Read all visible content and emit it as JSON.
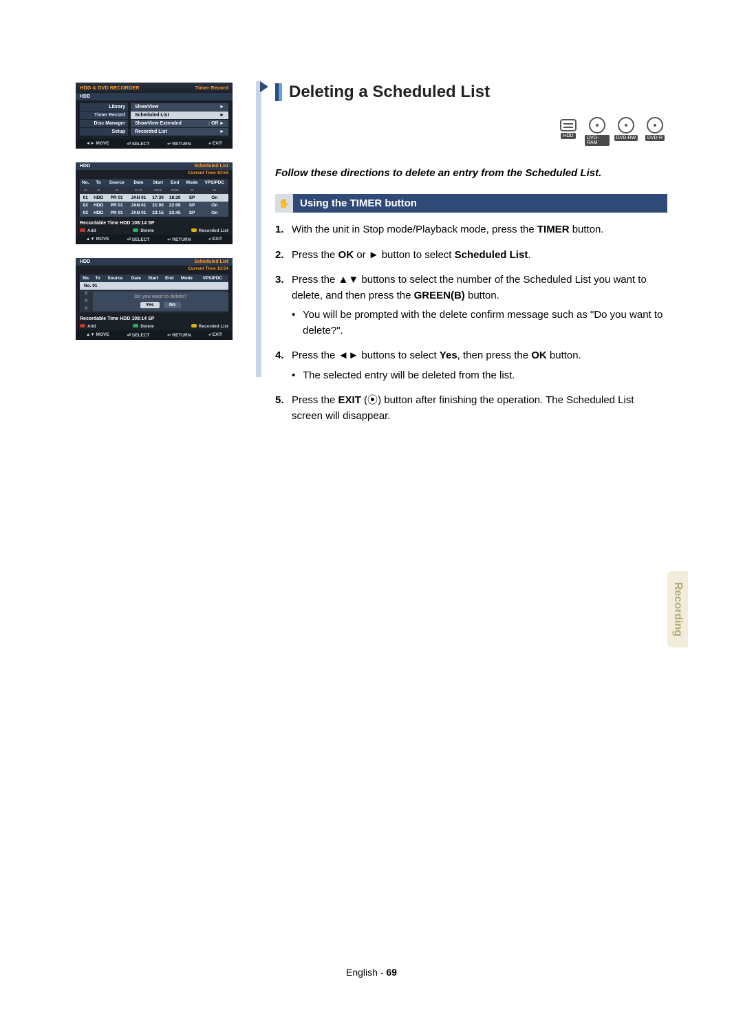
{
  "section_title": "Deleting a Scheduled List",
  "lead": "Follow these directions to delete an entry from the Scheduled List.",
  "sub_heading": "Using the TIMER button",
  "discs": [
    "HDD",
    "DVD-RAM",
    "DVD-RW",
    "DVD-R"
  ],
  "steps": [
    {
      "pre": "With the unit in Stop mode/Playback mode, press the ",
      "bold1": "TIMER",
      "post": " button."
    },
    {
      "pre": "Press the ",
      "bold1": "OK",
      "mid": " or ► button to select ",
      "bold2": "Scheduled List",
      "post": "."
    },
    {
      "pre": "Press the ▲▼ buttons to select the number of the Scheduled List you want to delete, and then press the ",
      "bold1": "GREEN(B)",
      "post": " button.",
      "bullets": [
        "You will be prompted with the delete confirm message such as \"Do you want to delete?\"."
      ]
    },
    {
      "pre": "Press the ◄► buttons to select ",
      "bold1": "Yes",
      "mid": ", then press the ",
      "bold2": "OK",
      "post": " button.",
      "bullets": [
        "The selected entry will be deleted from the list."
      ]
    },
    {
      "pre": "Press the ",
      "bold1": "EXIT",
      "mid": " (",
      "icon": "⦿",
      "mid2": ") button after finishing the operation. The Scheduled List screen will disappear."
    }
  ],
  "side_tab": "Recording",
  "page_footer_lang": "English",
  "page_footer_num": "69",
  "osd1": {
    "title_left": "HDD & DVD RECORDER",
    "title_right": "Timer Record",
    "sub_left": "HDD",
    "menu_left": [
      "Library",
      "Timer Record",
      "Disc Manager",
      "Setup"
    ],
    "menu_right": [
      {
        "l": "ShowView",
        "r": "►"
      },
      {
        "l": "Scheduled List",
        "r": "►",
        "hi": true
      },
      {
        "l": "ShowView Extended",
        "r": ": Off     ►"
      },
      {
        "l": "Recorded List",
        "r": "►"
      }
    ],
    "footer": [
      "◄► MOVE",
      "⏎ SELECT",
      "↩ RETURN",
      "⤶ EXIT"
    ]
  },
  "osd_sched": {
    "sub_left": "HDD",
    "sub_right": "Scheduled List",
    "time_label": "Current Time 10:54",
    "headers": [
      "No.",
      "To",
      "Source",
      "Date",
      "Start",
      "End",
      "Mode",
      "VPS/PDC"
    ],
    "rows": [
      [
        "--",
        "--",
        "--",
        "-- --",
        "--:--",
        "--:--",
        "--",
        "--"
      ],
      [
        "01",
        "HDD",
        "PR 01",
        "JAN 01",
        "17:30",
        "18:30",
        "SP",
        "On"
      ],
      [
        "02",
        "HDD",
        "PR 01",
        "JAN 01",
        "21:00",
        "22:00",
        "SP",
        "On"
      ],
      [
        "03",
        "HDD",
        "PR 01",
        "JAN 01",
        "23:15",
        "23:45",
        "SP",
        "On"
      ]
    ],
    "rec_time": "Recordable Time   HDD  108:14 SP",
    "legend": [
      "Add",
      "Delete",
      "Recorded List"
    ],
    "footer": [
      "▲▼ MOVE",
      "⏎ SELECT",
      "↩ RETURN",
      "⤶ EXIT"
    ]
  },
  "osd_dlg": {
    "sub_left": "HDD",
    "sub_right": "Scheduled List",
    "time_label": "Current Time 10:54",
    "headers": [
      "No.",
      "To",
      "Source",
      "Date",
      "Start",
      "End",
      "Mode",
      "VPS/PDC"
    ],
    "row_label": "No. 01",
    "msg": "Do you want to delete?",
    "yes": "Yes",
    "no": "No",
    "rec_time": "Recordable Time   HDD  108:14 SP",
    "legend": [
      "Add",
      "Delete",
      "Recorded List"
    ],
    "footer": [
      "▲▼ MOVE",
      "⏎ SELECT",
      "↩ RETURN",
      "⤶ EXIT"
    ]
  }
}
